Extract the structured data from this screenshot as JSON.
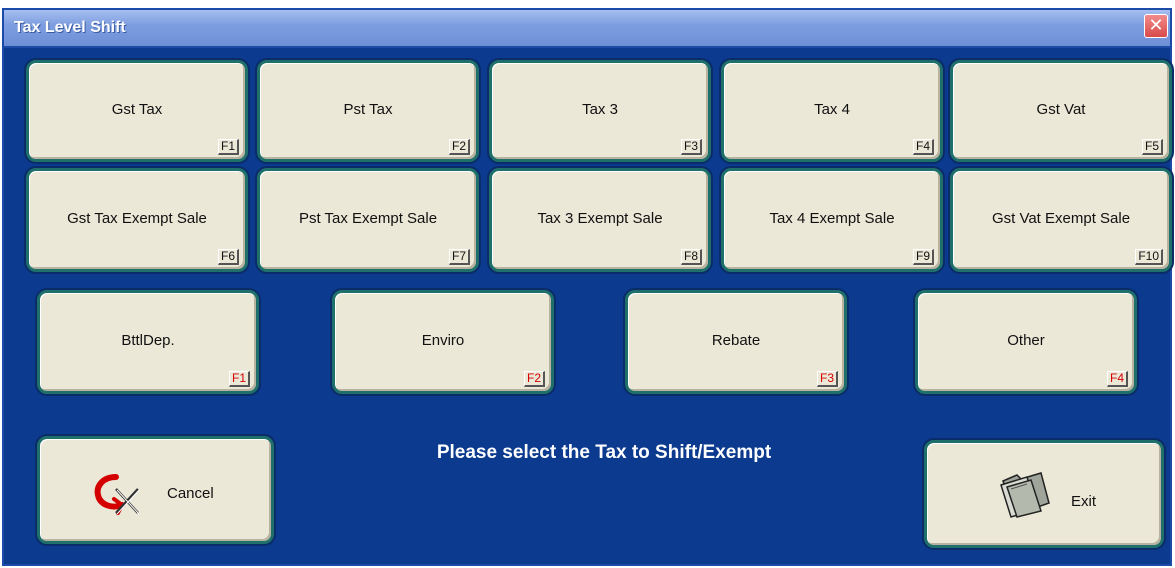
{
  "window": {
    "title": "Tax Level Shift",
    "close_symbol": "✕"
  },
  "tax_buttons": [
    {
      "label": "Gst Tax",
      "key": "F1"
    },
    {
      "label": "Pst Tax",
      "key": "F2"
    },
    {
      "label": "Tax 3",
      "key": "F3"
    },
    {
      "label": "Tax 4",
      "key": "F4"
    },
    {
      "label": "Gst Vat",
      "key": "F5"
    },
    {
      "label": "Gst Tax Exempt Sale",
      "key": "F6"
    },
    {
      "label": "Pst Tax Exempt Sale",
      "key": "F7"
    },
    {
      "label": "Tax 3 Exempt Sale",
      "key": "F8"
    },
    {
      "label": "Tax 4 Exempt Sale",
      "key": "F9"
    },
    {
      "label": "Gst Vat Exempt Sale",
      "key": "F10"
    }
  ],
  "fee_buttons": [
    {
      "label": "BttlDep.",
      "key": "F1"
    },
    {
      "label": "Enviro",
      "key": "F2"
    },
    {
      "label": "Rebate",
      "key": "F3"
    },
    {
      "label": "Other",
      "key": "F4"
    }
  ],
  "prompt": "Please select the Tax to Shift/Exempt",
  "cancel": {
    "label": "Cancel",
    "icon": "cancel-icon"
  },
  "exit": {
    "label": "Exit",
    "icon": "folder-icon"
  },
  "colors": {
    "background": "#0b3a8f",
    "button": "#ece8d8",
    "border": "#1f6f6a",
    "key_red": "#d40000"
  }
}
